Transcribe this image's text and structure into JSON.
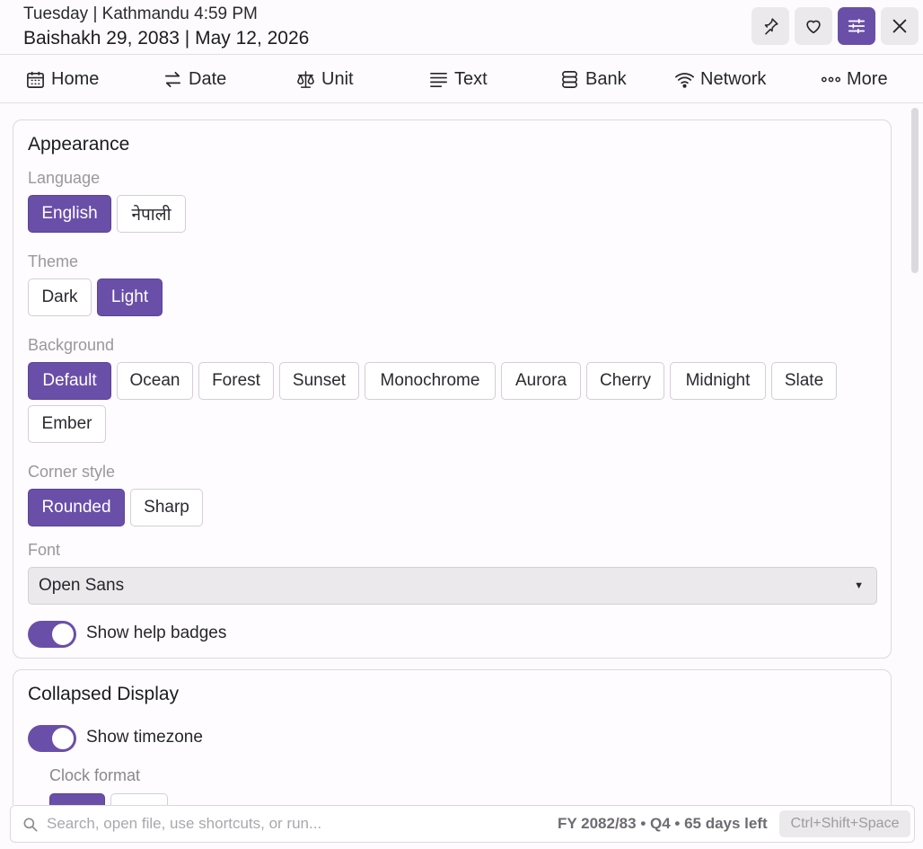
{
  "header": {
    "line1": "Tuesday | Kathmandu 4:59 PM",
    "line2": "Baishakh 29, 2083 | May 12, 2026",
    "buttons": [
      {
        "icon": "pin-icon"
      },
      {
        "icon": "heart-icon"
      },
      {
        "icon": "sliders-icon",
        "active": true
      },
      {
        "icon": "close-icon"
      }
    ]
  },
  "nav": {
    "items": [
      {
        "label": "Home",
        "icon": "calendar-icon"
      },
      {
        "label": "Date",
        "icon": "swap-arrows-icon"
      },
      {
        "label": "Unit",
        "icon": "scale-icon"
      },
      {
        "label": "Text",
        "icon": "text-lines-icon"
      },
      {
        "label": "Bank",
        "icon": "database-icon"
      },
      {
        "label": "Network",
        "icon": "wifi-icon"
      },
      {
        "label": "More",
        "icon": "dots-icon"
      }
    ]
  },
  "appearance": {
    "title": "Appearance",
    "language": {
      "label": "Language",
      "options": [
        "English",
        "नेपाली"
      ],
      "selected": "English"
    },
    "theme": {
      "label": "Theme",
      "options": [
        "Dark",
        "Light"
      ],
      "selected": "Light"
    },
    "background": {
      "label": "Background",
      "options": [
        "Default",
        "Ocean",
        "Forest",
        "Sunset",
        "Monochrome",
        "Aurora",
        "Cherry",
        "Midnight",
        "Slate",
        "Ember"
      ],
      "selected": "Default"
    },
    "corner_style": {
      "label": "Corner style",
      "options": [
        "Rounded",
        "Sharp"
      ],
      "selected": "Rounded"
    },
    "font": {
      "label": "Font",
      "value": "Open Sans"
    },
    "help_badges": {
      "label": "Show help badges",
      "on": true
    }
  },
  "collapsed": {
    "title": "Collapsed Display",
    "timezone": {
      "label": "Show timezone",
      "on": true
    },
    "clock_format": {
      "label": "Clock format"
    }
  },
  "bottom": {
    "search_placeholder": "Search, open file, use shortcuts, or run...",
    "fy_info": "FY 2082/83 • Q4 • 65 days left",
    "shortcut": "Ctrl+Shift+Space"
  },
  "colors": {
    "accent": "#6a4fa8",
    "background": "#fdfbfd",
    "muted_label": "#9a979d"
  }
}
